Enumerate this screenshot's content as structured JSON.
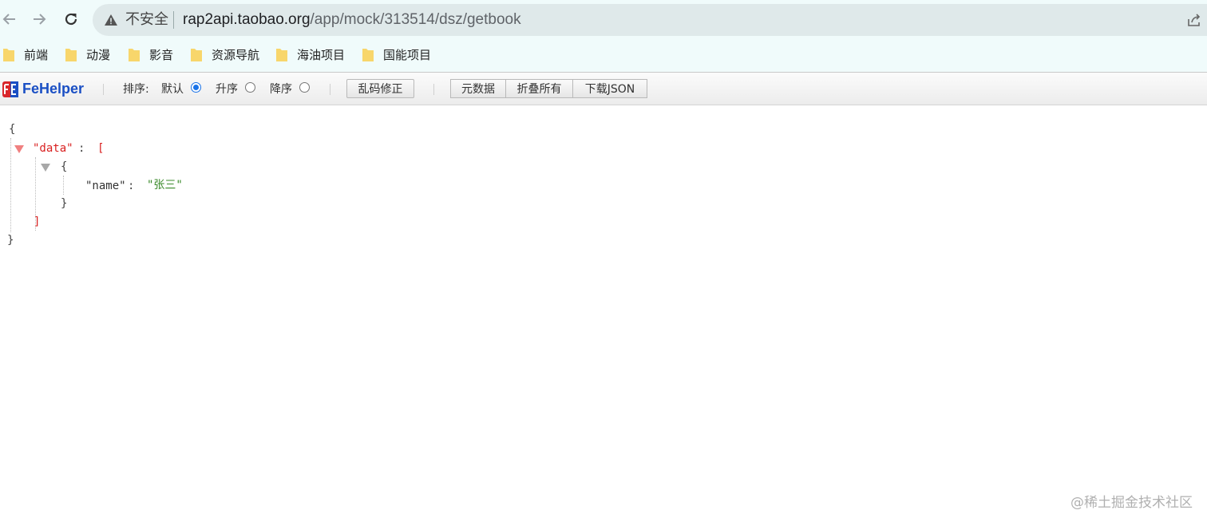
{
  "browser": {
    "security_label": "不安全",
    "url_host": "rap2api.taobao.org",
    "url_path": "/app/mock/313514/dsz/getbook",
    "icons": [
      "back-arrow-icon",
      "forward-arrow-icon",
      "reload-icon",
      "warning-triangle-icon",
      "share-icon"
    ]
  },
  "bookmarks": [
    {
      "label": "前端"
    },
    {
      "label": "动漫"
    },
    {
      "label": "影音"
    },
    {
      "label": "资源导航"
    },
    {
      "label": "海油项目"
    },
    {
      "label": "国能项目"
    }
  ],
  "fehelper": {
    "brand": "FeHelper",
    "sort_label": "排序:",
    "sort_options": [
      {
        "label": "默认",
        "checked": true
      },
      {
        "label": "升序",
        "checked": false
      },
      {
        "label": "降序",
        "checked": false
      }
    ],
    "fix_encoding_button": "乱码修正",
    "buttons": [
      "元数据",
      "折叠所有",
      "下载JSON"
    ]
  },
  "json_view": {
    "open_brace": "{",
    "data_key": "\"data\"",
    "colon": ":",
    "open_bracket": "[",
    "item_open_brace": "{",
    "name_key": "\"name\"",
    "name_value": "\"张三\"",
    "item_close_brace": "}",
    "close_bracket": "]",
    "close_brace": "}"
  },
  "watermark": "@稀土掘金技术社区",
  "colors": {
    "chrome_bg": "#f0fbfb",
    "address_bar": "#dfe9ea",
    "fehelper_blue": "#1a4fc4",
    "json_red": "#d92020",
    "json_string": "#3a8a2a",
    "radio_blue": "#1a73e8"
  }
}
